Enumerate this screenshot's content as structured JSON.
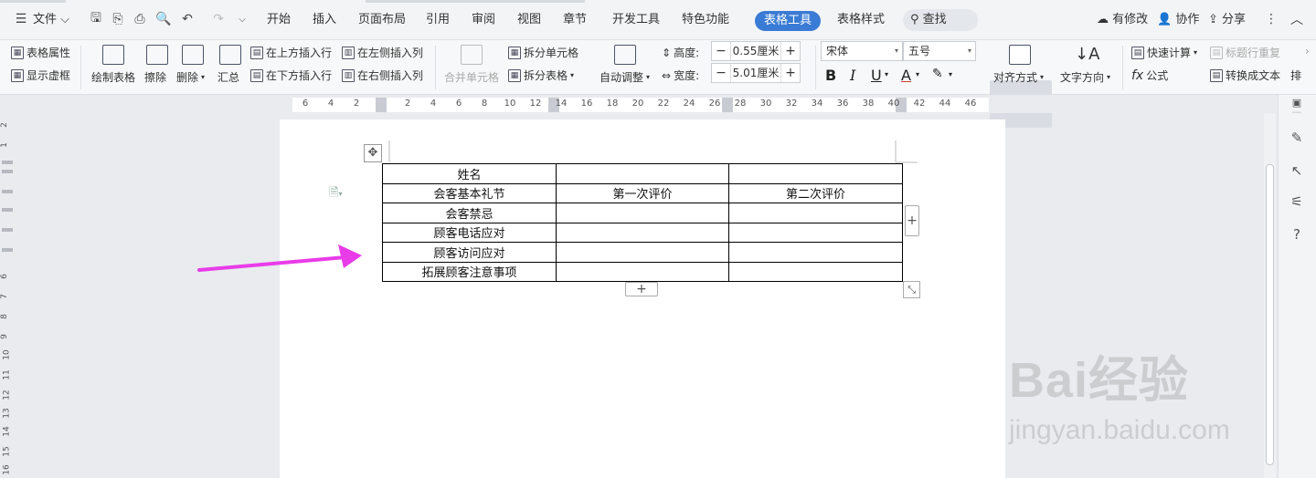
{
  "topbar": {
    "menu_label": "文件",
    "tabs": [
      "开始",
      "插入",
      "页面布局",
      "引用",
      "审阅",
      "视图",
      "章节",
      "开发工具",
      "特色功能"
    ],
    "active_tab": "表格工具",
    "context_tab": "表格样式",
    "search_label": "查找",
    "modified_label": "有修改",
    "collab_label": "协作",
    "share_label": "分享"
  },
  "ribbon": {
    "table_props": "表格属性",
    "show_gridlines": "显示虚框",
    "draw_table": "绘制表格",
    "erase": "擦除",
    "delete": "删除",
    "summary": "汇总",
    "insert_above": "在上方插入行",
    "insert_below": "在下方插入行",
    "insert_left": "在左侧插入列",
    "insert_right": "在右侧插入列",
    "merge_cells": "合并单元格",
    "split_cells": "拆分单元格",
    "split_table": "拆分表格",
    "auto_fit": "自动调整",
    "height_label": "高度:",
    "height_value": "0.55厘米",
    "width_label": "宽度:",
    "width_value": "5.01厘米",
    "font_name": "宋体",
    "font_size": "五号",
    "align": "对齐方式",
    "text_direction": "文字方向",
    "quick_calc": "快速计算",
    "repeat_header": "标题行重复",
    "formula": "公式",
    "to_text": "转换成文本",
    "sort_partial": "排"
  },
  "ruler": {
    "h_ticks": [
      "6",
      "4",
      "2",
      "2",
      "4",
      "6",
      "8",
      "10",
      "12",
      "14",
      "16",
      "18",
      "20",
      "22",
      "24",
      "26",
      "28",
      "30",
      "32",
      "34",
      "36",
      "38",
      "40",
      "42",
      "44",
      "46"
    ],
    "v_ticks": [
      "2",
      "1",
      "6",
      "7",
      "8",
      "9",
      "10",
      "11",
      "12",
      "13",
      "14",
      "15",
      "16"
    ]
  },
  "table": {
    "rows": [
      [
        "姓名",
        "",
        ""
      ],
      [
        "会客基本礼节",
        "第一次评价",
        "第二次评价"
      ],
      [
        "会客禁忌",
        "",
        ""
      ],
      [
        "顾客电话应对",
        "",
        ""
      ],
      [
        "顾客访问应对",
        "",
        ""
      ],
      [
        "拓展顾客注意事项",
        "",
        ""
      ]
    ]
  },
  "colors": {
    "arrow": "#e83ce8",
    "active_tab": "#3a7bd5"
  },
  "watermark": {
    "main": "Bai经验",
    "sub": "jingyan.baidu.com"
  }
}
